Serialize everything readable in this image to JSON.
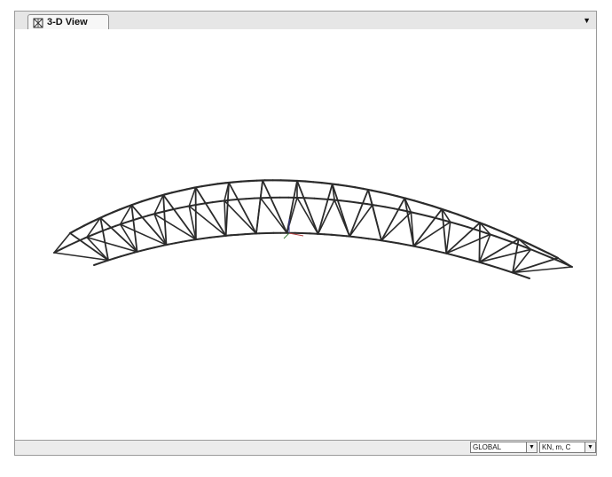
{
  "tab": {
    "label": "3-D View",
    "icon": "3d-frame-icon"
  },
  "statusbar": {
    "coord_system": "GLOBAL",
    "units": "KN, m, C"
  },
  "colors": {
    "structure": "#2b2b2b",
    "axis_x": "#b04040",
    "axis_y": "#3a7a3a",
    "axis_z": "#3a3aa0"
  }
}
